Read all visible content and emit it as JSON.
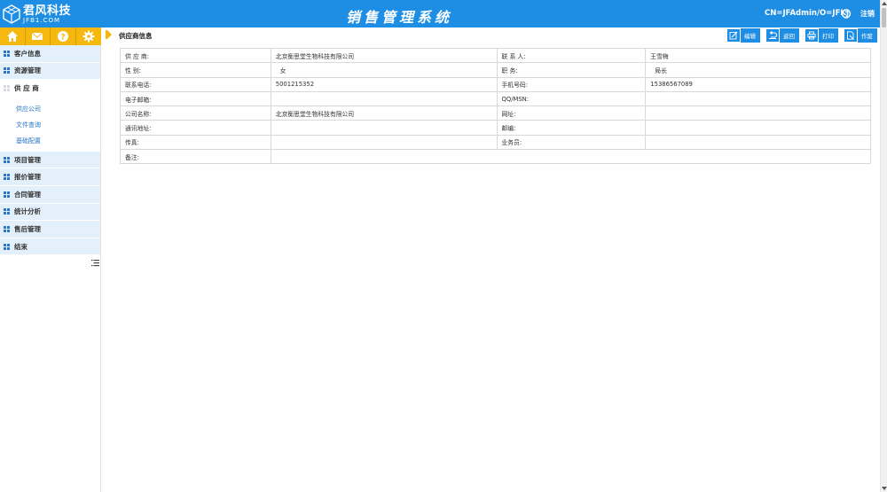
{
  "header": {
    "logo_cn": "君风科技",
    "logo_en": "JFB1.COM",
    "app_title": "销售管理系统",
    "user_dn": "CN=JFAdmin/O=JFKJ",
    "logout_label": "注销"
  },
  "toolbar": {
    "icons": [
      "home-icon",
      "mail-icon",
      "help-icon",
      "settings-icon"
    ],
    "accent_color": "#f5b80f"
  },
  "sidebar": {
    "items": [
      {
        "label": "客户信息"
      },
      {
        "label": "资源管理"
      },
      {
        "label": "供 应 商",
        "expanded": true,
        "children": [
          "供应公司",
          "文件查询",
          "基础配置"
        ]
      },
      {
        "label": "项目管理"
      },
      {
        "label": "报价管理"
      },
      {
        "label": "合同管理"
      },
      {
        "label": "统计分析"
      },
      {
        "label": "售后管理"
      },
      {
        "label": "结束"
      }
    ]
  },
  "page": {
    "title": "供应商信息",
    "actions": [
      "编辑",
      "返回",
      "打印",
      "作废"
    ]
  },
  "fields": {
    "supplier_label": "供 应 商:",
    "supplier_value": "北京衡思堂生物科技有限公司",
    "contact_label": "联 系 人:",
    "contact_value": "王雪梅",
    "gender_label": "性 别:",
    "gender_value": "女",
    "position_label": "职 务:",
    "position_value": "局长",
    "phone_label": "联系电话:",
    "phone_value": "5001215352",
    "mobile_label": "手机号码:",
    "mobile_value": "15386567089",
    "email_label": "电子邮箱:",
    "email_value": "",
    "qq_label": "QQ/MSN:",
    "qq_value": "",
    "company_label": "公司名称:",
    "company_value": "北京衡思堂生物科技有限公司",
    "website_label": "网址:",
    "website_value": "",
    "address_label": "通讯地址:",
    "address_value": "",
    "zip_label": "邮编:",
    "zip_value": "",
    "fax_label": "传真:",
    "fax_value": "",
    "salesman_label": "业务员:",
    "salesman_value": "",
    "remark_label": "备注:",
    "remark_value": ""
  },
  "colors": {
    "header_blue": "#1d8ee4",
    "menu_bg": "#e3f0fb",
    "link_blue": "#2a76c8"
  }
}
